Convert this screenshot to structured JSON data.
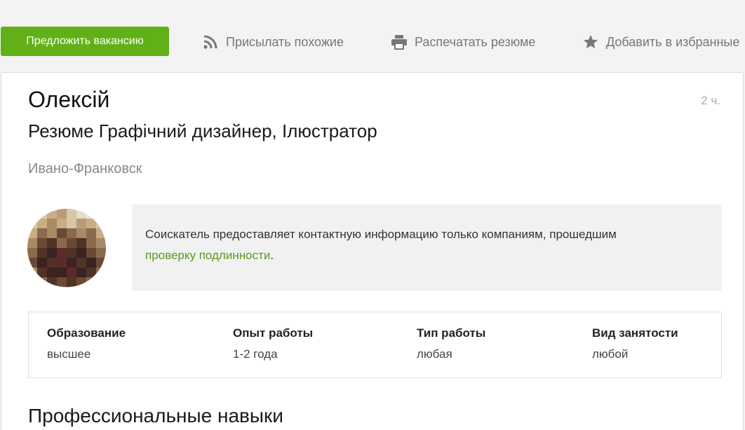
{
  "toolbar": {
    "offer_button": "Предложить вакансию",
    "similar_label": "Присылать похожие",
    "print_label": "Распечатать резюме",
    "favorite_label": "Добавить в избранные",
    "icons": [
      "rss-icon",
      "printer-icon",
      "star-icon"
    ]
  },
  "profile": {
    "name": "Олексій",
    "time_ago": "2 ч.",
    "resume_title": "Резюме Графічний дизайнер, Ілюстратор",
    "city": "Ивано-Франковск"
  },
  "notice": {
    "text": "Соискатель предоставляет контактную информацию только компаниям, прошедшим",
    "link": "проверку подлинности",
    "suffix": "."
  },
  "info": [
    {
      "label": "Образование",
      "value": "высшее"
    },
    {
      "label": "Опыт работы",
      "value": "1-2 года"
    },
    {
      "label": "Тип работы",
      "value": "любая"
    },
    {
      "label": "Вид занятости",
      "value": "любой"
    }
  ],
  "sections": {
    "skills_title": "Профессиональные навыки"
  },
  "colors": {
    "accent": "#62b017",
    "link": "#5a9a1e"
  }
}
